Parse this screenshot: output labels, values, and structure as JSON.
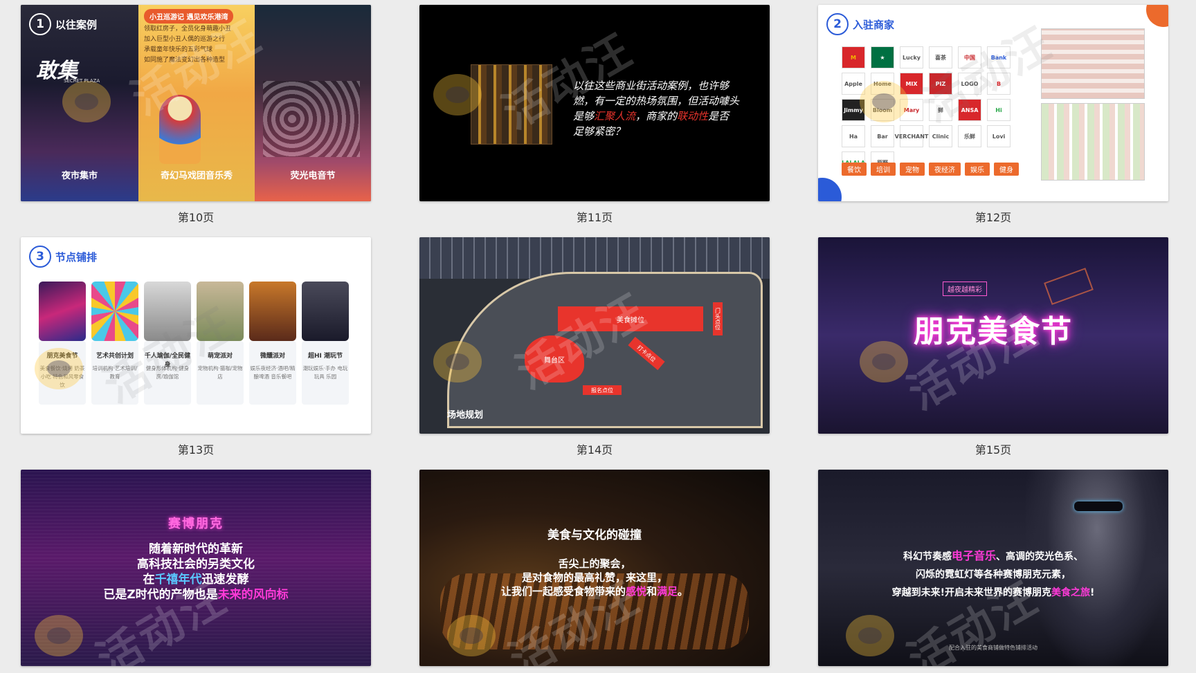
{
  "slides": [
    {
      "caption": "第10页",
      "badge_num": "1",
      "title": "以往案例",
      "banner": "小丑巡游记 遇见欢乐港湾",
      "desc_lines": [
        "领取红房子，全员化身萌趣小丑",
        "加入巨型小丑人偶的巡游之行",
        "承载童年快乐的五彩气球",
        "如同施了魔法变幻出各种造型"
      ],
      "logo_text": "敢集",
      "logo_sub": "SECRET PLAZA",
      "panel_labels": [
        "夜市集市",
        "奇幻马戏团音乐秀",
        "荧光电音节"
      ]
    },
    {
      "caption": "第11页",
      "text_parts": [
        "以往这些商业街活动案例，也许够燃，有一定的热场氛围，但活动噱头是够",
        "汇聚人流",
        "，商家的",
        "联动性",
        "是否足够紧密？"
      ]
    },
    {
      "caption": "第12页",
      "badge_num": "2",
      "title": "入驻商家",
      "logos": [
        "M",
        "★",
        "Lucky",
        "喜茶",
        "中国",
        "Bank",
        "Apple",
        "Home",
        "MIX",
        "PIZ",
        "LOGO",
        "B",
        "Jimmy",
        "Bloom",
        "Mary",
        "鲜",
        "ANSA",
        "Hi",
        "Ha",
        "Bar",
        "VERCHANT",
        "Clinic",
        "乐鲜",
        "Lovi",
        "LALALA",
        "原野"
      ],
      "categories": [
        "餐饮",
        "培训",
        "宠物",
        "夜经济",
        "娱乐",
        "健身"
      ]
    },
    {
      "caption": "第13页",
      "badge_num": "3",
      "title": "节点铺排",
      "cards": [
        {
          "label": "朋克美食节",
          "desc": "美食餐饮·烧烤 奶茶 小吃 特色和风零食饮"
        },
        {
          "label": "艺术共创计划",
          "desc": "培训机构·艺术培训/教育"
        },
        {
          "label": "千人瑜伽/全民健身",
          "desc": "健身形体机构·健身房/瑜伽馆"
        },
        {
          "label": "萌宠派对",
          "desc": "宠物机构·猫咖/宠物店"
        },
        {
          "label": "微醺派对",
          "desc": "娱乐夜经济·酒吧/精酿啤酒 音乐餐吧"
        },
        {
          "label": "超HI 潮玩节",
          "desc": "潮玩娱乐·手办 电玩 玩具 乐园"
        }
      ],
      "logo_hint": "朋克美食节"
    },
    {
      "caption": "第14页",
      "labels": [
        "美食摊位",
        "门头点位",
        "舞台区",
        "打卡点位",
        "报名点位",
        "场地规划"
      ]
    },
    {
      "caption": "第15页",
      "title": "朋克美食节",
      "sign": "越夜越精彩"
    },
    {
      "caption": "",
      "title": "赛博朋克",
      "lines_a": [
        "随着新时代的革新",
        "高科技社会的另类文化"
      ],
      "line3_parts": [
        "在",
        "千禧年代",
        "迅速发酵"
      ],
      "line4_parts": [
        "已是Z时代的产物也是",
        "未来的风向标"
      ]
    },
    {
      "caption": "",
      "title": "美食与文化的碰撞",
      "line1": "舌尖上的聚会，",
      "line2": "是对食物的最高礼赞，来这里，",
      "line3_parts": [
        "让我们一起感受食物带来的",
        "感悦",
        "和",
        "满足",
        "。"
      ]
    },
    {
      "caption": "",
      "line1_parts": [
        "科幻节奏感",
        "电子音乐",
        "、高调的荧光色系、"
      ],
      "line2": "闪烁的霓虹灯等各种赛博朋克元素，",
      "line3_parts": [
        "穿越到未来!开启未来世界的赛博朋克",
        "美食之旅",
        "!"
      ],
      "footnote": "配合入驻的美食商铺做特色铺排活动"
    }
  ],
  "watermark": "活动汪",
  "colors": {
    "accent_red": "#e8342c",
    "accent_pink": "#ff3ad8",
    "accent_orange": "#ec6a2c",
    "accent_blue": "#2b5bd8"
  }
}
